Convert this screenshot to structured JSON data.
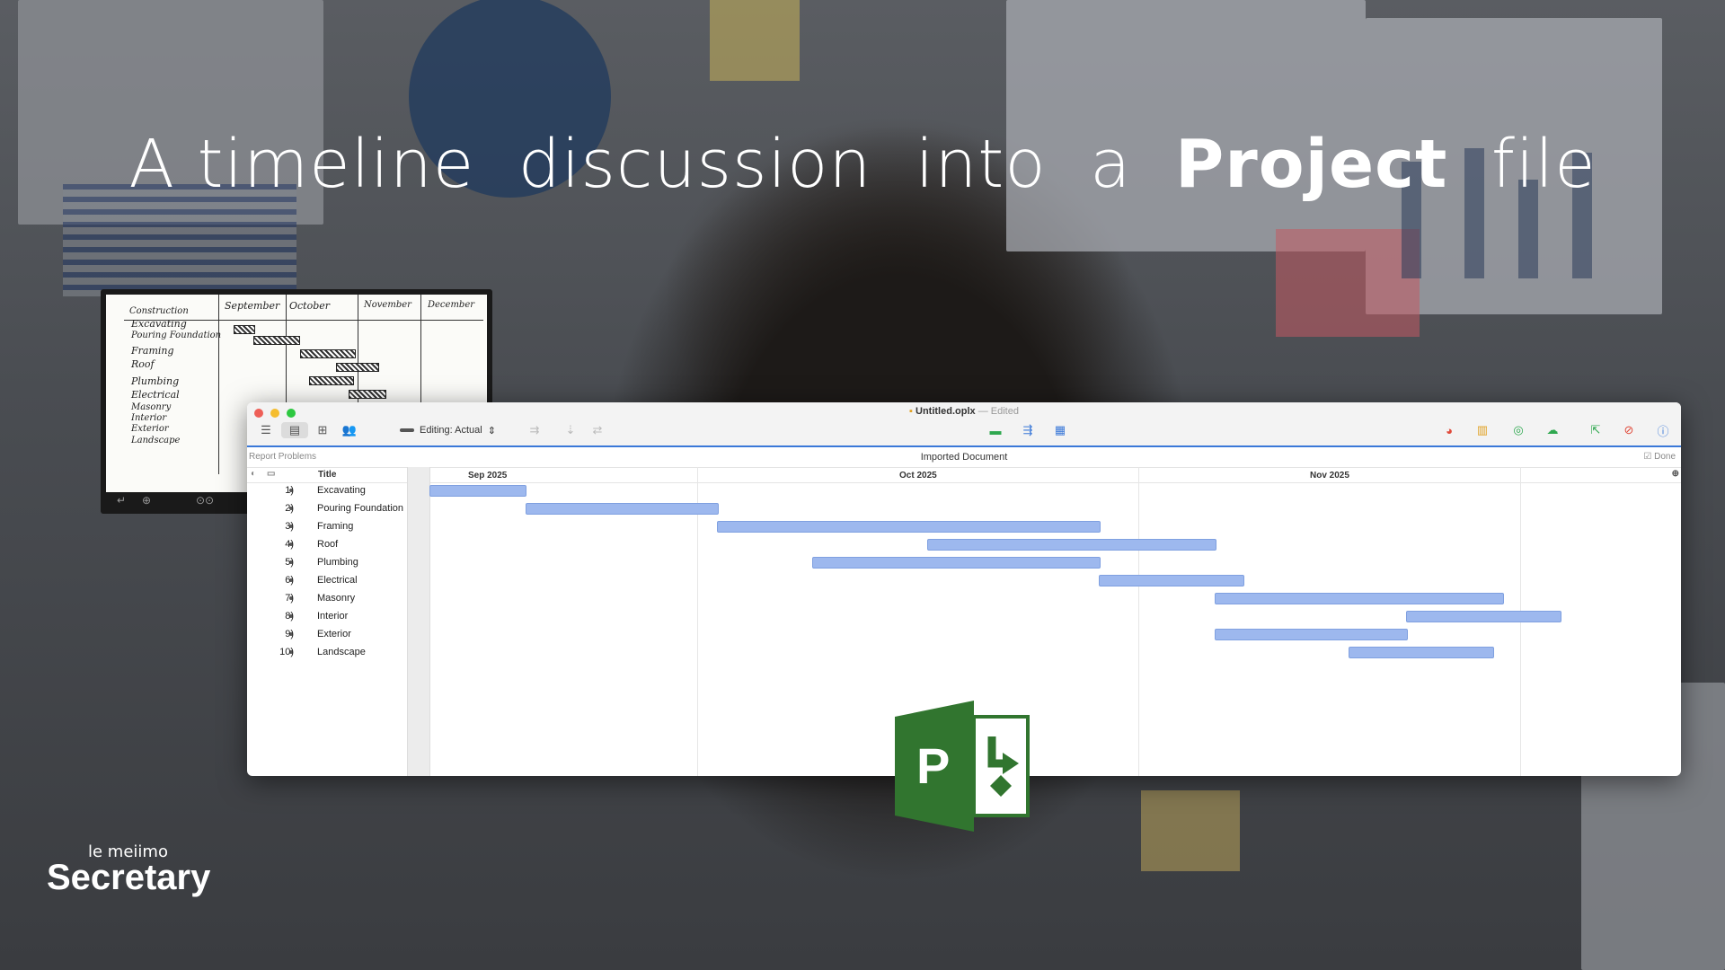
{
  "headline": {
    "part1": "A timeline",
    "part2": "discussion",
    "part3": "into",
    "part4": "a",
    "bold": "Project",
    "part5": "file"
  },
  "sketch": {
    "header": "Construction",
    "months": [
      "September",
      "October",
      "November",
      "December"
    ],
    "tasks": [
      "Excavating",
      "Pouring Foundation",
      "Framing",
      "Roof",
      "Plumbing",
      "Electrical",
      "Masonry",
      "Interior",
      "Exterior",
      "Landscape"
    ]
  },
  "window": {
    "title": "Untitled.oplx",
    "status": "— Edited",
    "editing_label": "Editing: Actual",
    "report_problems": "Report Problems",
    "imported": "Imported Document",
    "done": "Done",
    "col_title": "Title",
    "months": [
      "Sep 2025",
      "Oct 2025",
      "Nov 2025"
    ],
    "tasks": [
      {
        "num": "1)",
        "label": "Excavating"
      },
      {
        "num": "2)",
        "label": "Pouring Foundation"
      },
      {
        "num": "3)",
        "label": "Framing"
      },
      {
        "num": "4)",
        "label": "Roof"
      },
      {
        "num": "5)",
        "label": "Plumbing"
      },
      {
        "num": "6)",
        "label": "Electrical"
      },
      {
        "num": "7)",
        "label": "Masonry"
      },
      {
        "num": "8)",
        "label": "Interior"
      },
      {
        "num": "9)",
        "label": "Exterior"
      },
      {
        "num": "10)",
        "label": "Landscape"
      }
    ],
    "accent": "#3a78d8",
    "bar_color": "#9db8ee"
  },
  "brand": {
    "le": "le meiimo",
    "name": "Secretary"
  },
  "colors": {
    "msp_green": "#31752f"
  }
}
